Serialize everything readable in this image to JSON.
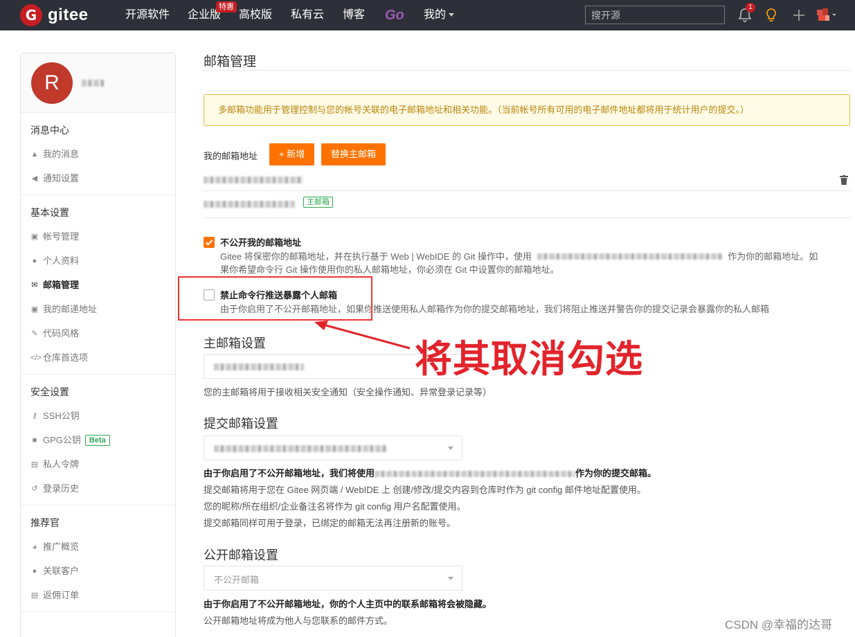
{
  "topnav": {
    "logo_mark": "G",
    "logo_text": "gitee",
    "items": [
      "开源软件",
      "企业版",
      "高校版",
      "私有云",
      "博客"
    ],
    "hot_badge": "特惠",
    "go_label": "Go",
    "mine_label": "我的",
    "search_placeholder": "搜开源",
    "notification_count": "1"
  },
  "sidebar": {
    "avatar_letter": "R",
    "groups": [
      {
        "title": "消息中心",
        "items": [
          {
            "label": "我的消息",
            "icon": "bell-icon"
          },
          {
            "label": "通知设置",
            "icon": "volume-icon"
          }
        ]
      },
      {
        "title": "基本设置",
        "items": [
          {
            "label": "帐号管理",
            "icon": "id-card-icon"
          },
          {
            "label": "个人资料",
            "icon": "user-icon"
          },
          {
            "label": "邮箱管理",
            "icon": "envelope-icon",
            "active": true
          },
          {
            "label": "我的邮递地址",
            "icon": "address-card-icon"
          },
          {
            "label": "代码风格",
            "icon": "brush-icon"
          },
          {
            "label": "仓库首选项",
            "icon": "code-icon"
          }
        ]
      },
      {
        "title": "安全设置",
        "items": [
          {
            "label": "SSH公钥",
            "icon": "key-icon"
          },
          {
            "label": "GPG公钥",
            "icon": "lock-icon",
            "badge": "Beta"
          },
          {
            "label": "私人令牌",
            "icon": "token-icon"
          },
          {
            "label": "登录历史",
            "icon": "history-icon"
          }
        ]
      },
      {
        "title": "推荐官",
        "items": [
          {
            "label": "推广概览",
            "icon": "dashboard-icon"
          },
          {
            "label": "关联客户",
            "icon": "users-icon"
          },
          {
            "label": "返佣订单",
            "icon": "receipt-icon"
          }
        ]
      }
    ]
  },
  "main": {
    "title": "邮箱管理",
    "notice": "多邮箱功能用于管理控制与您的帐号关联的电子邮箱地址和相关功能。（当前帐号所有可用的电子邮件地址都将用于统计用户的提交。）",
    "my_emails_label": "我的邮箱地址",
    "add_button": "+ 新增",
    "replace_button": "替换主邮箱",
    "primary_tag": "主邮箱",
    "hide_email": {
      "checked": true,
      "title": "不公开我的邮箱地址",
      "desc_1": "Gitee 将保密你的邮箱地址，并在执行基于 Web | WebIDE 的 Git 操作中，使用",
      "desc_2": "作为你的邮箱地址。如",
      "desc_3": "果你希望命令行 Git 操作使用你的私人邮箱地址，你必须在 Git 中设置你的邮箱地址。"
    },
    "block_push": {
      "checked": false,
      "title": "禁止命令行推送暴露个人邮箱",
      "desc": "由于你启用了不公开邮箱地址，如果你推送使用私人邮箱作为你的提交邮箱地址，我们将阻止推送并警告你的提交记录会暴露你的私人邮箱"
    },
    "primary_section": {
      "title": "主邮箱设置",
      "help": "您的主邮箱将用于接收相关安全通知（安全操作通知、异常登录记录等）"
    },
    "commit_section": {
      "title": "提交邮箱设置",
      "help_bold_1": "由于你启用了不公开邮箱地址，我们将使用",
      "help_bold_2": "作为你的提交邮箱。",
      "help_1": "提交邮箱将用于您在 Gitee 网页端 / WebIDE 上 创建/修改/提交内容到仓库时作为 git config 邮件地址配置使用。",
      "help_2": "您的昵称/所在组织/企业备注名将作为 git config 用户名配置使用。",
      "help_3": "提交邮箱同样可用于登录，已绑定的邮箱无法再注册新的账号。"
    },
    "public_section": {
      "title": "公开邮箱设置",
      "select_value": "不公开邮箱",
      "help_bold": "由于你启用了不公开邮箱地址，你的个人主页中的联系邮箱将会被隐藏。",
      "help": "公开邮箱地址将成为他人与您联系的邮件方式。"
    }
  },
  "annotation": "将其取消勾选",
  "watermark": "CSDN @幸福的达哥",
  "colors": {
    "brand": "#c71d23",
    "accent": "#fe7300",
    "annotation": "#e3232b",
    "success": "#2da94f"
  }
}
